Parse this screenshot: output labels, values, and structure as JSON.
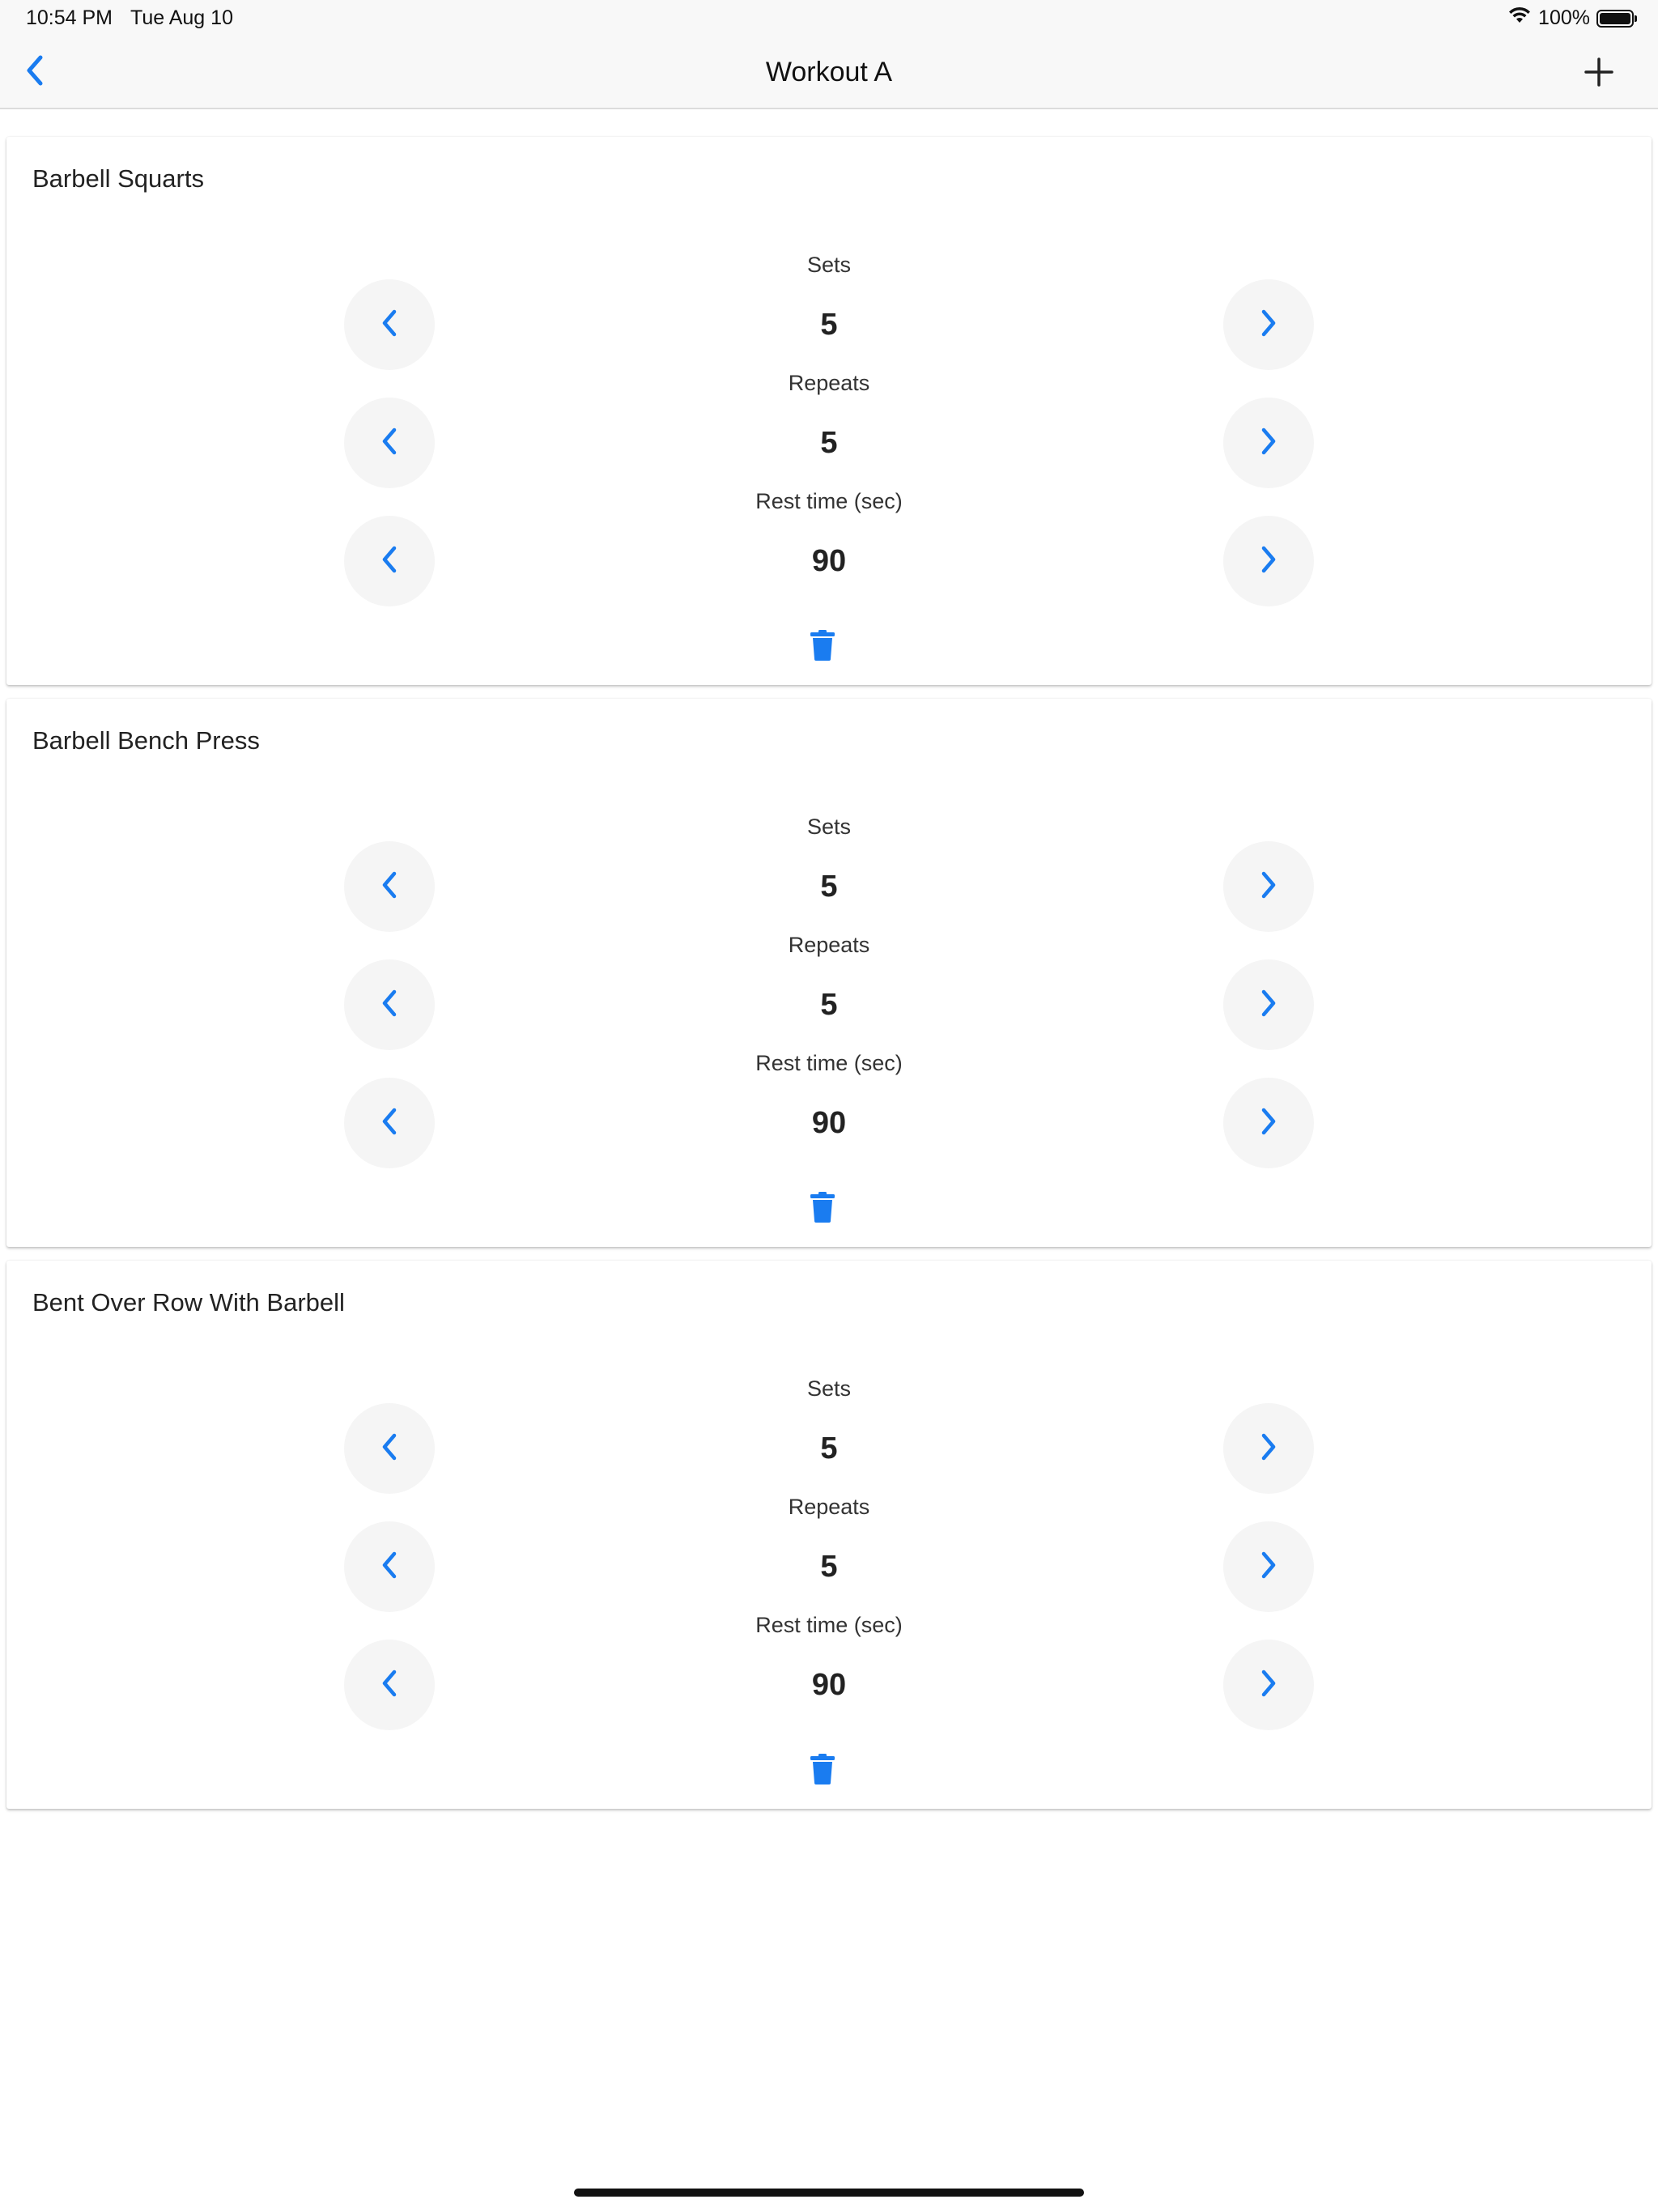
{
  "status_bar": {
    "time": "10:54 PM",
    "date": "Tue Aug 10",
    "battery": "100%",
    "icons": [
      "wifi-icon",
      "battery-icon"
    ]
  },
  "nav": {
    "title": "Workout A",
    "back_icon": "chevron-left-icon",
    "add_icon": "plus-icon"
  },
  "colors": {
    "accent": "#1a7cf0",
    "button_bg": "#f5f5f5",
    "bar_bg": "#f8f8f8"
  },
  "exercises": [
    {
      "name": "Barbell Squarts",
      "sets_label": "Sets",
      "sets": "5",
      "repeats_label": "Repeats",
      "repeats": "5",
      "rest_label": "Rest time (sec)",
      "rest": "90"
    },
    {
      "name": "Barbell Bench Press",
      "sets_label": "Sets",
      "sets": "5",
      "repeats_label": "Repeats",
      "repeats": "5",
      "rest_label": "Rest time (sec)",
      "rest": "90"
    },
    {
      "name": "Bent Over Row With Barbell",
      "sets_label": "Sets",
      "sets": "5",
      "repeats_label": "Repeats",
      "repeats": "5",
      "rest_label": "Rest time (sec)",
      "rest": "90"
    }
  ]
}
